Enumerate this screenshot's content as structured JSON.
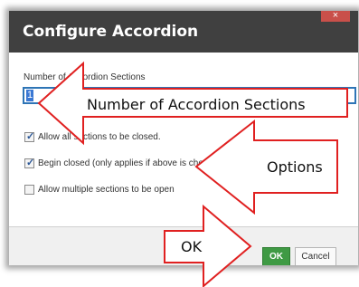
{
  "dialog": {
    "title": "Configure Accordion",
    "close_glyph": "×"
  },
  "field": {
    "label": "Number of Accordion Sections",
    "value": "1"
  },
  "options": [
    {
      "label": "Allow all sections to be closed.",
      "checked": true
    },
    {
      "label": "Begin closed (only applies if above is checked)",
      "checked": true
    },
    {
      "label": "Allow multiple sections to be open",
      "checked": false
    }
  ],
  "buttons": {
    "ok": "OK",
    "cancel": "Cancel"
  },
  "callouts": {
    "sections": "Number of Accordion Sections",
    "options": "Options",
    "ok": "OK"
  },
  "colors": {
    "titlebar": "#404040",
    "close": "#c9504a",
    "ok_button": "#3f9a44",
    "input_border": "#2e75b6",
    "callout_outline": "#e02020"
  },
  "icons": [
    "close-icon",
    "checkmark-icon"
  ]
}
